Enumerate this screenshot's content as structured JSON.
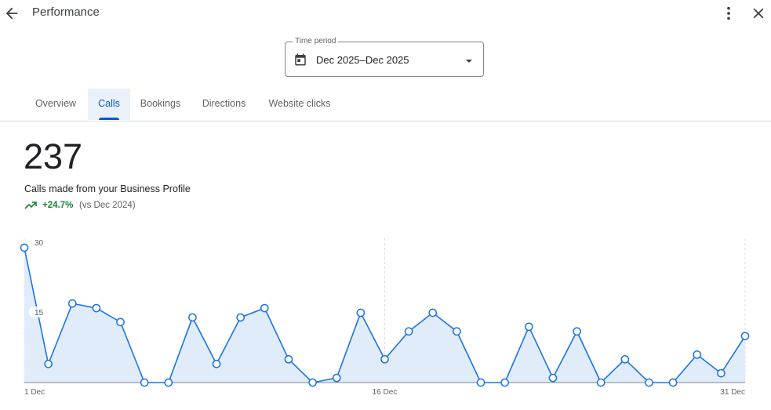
{
  "header": {
    "title": "Performance"
  },
  "time_period": {
    "label": "Time period",
    "value": "Dec 2025–Dec 2025"
  },
  "tabs": [
    {
      "label": "Overview",
      "active": false
    },
    {
      "label": "Calls",
      "active": true
    },
    {
      "label": "Bookings",
      "active": false
    },
    {
      "label": "Directions",
      "active": false
    },
    {
      "label": "Website clicks",
      "active": false
    }
  ],
  "summary": {
    "total": "237",
    "description": "Calls made from your Business Profile",
    "change": "+24.7%",
    "comparison": "(vs Dec 2024)"
  },
  "colors": {
    "accent": "#0b57d0",
    "line": "#1a73e8",
    "area": "#e1ecfb",
    "positive": "#188038"
  },
  "chart_data": {
    "type": "area",
    "x_tick_labels": [
      "1 Dec",
      "16 Dec",
      "31 Dec"
    ],
    "y_tick_labels": [
      "30",
      "15"
    ],
    "ylim": [
      0,
      30
    ],
    "x": [
      1,
      2,
      3,
      4,
      5,
      6,
      7,
      8,
      9,
      10,
      11,
      12,
      13,
      14,
      15,
      16,
      17,
      18,
      19,
      20,
      21,
      22,
      23,
      24,
      25,
      26,
      27,
      28,
      29,
      30,
      31
    ],
    "values": [
      29,
      4,
      17,
      16,
      13,
      0,
      0,
      14,
      4,
      14,
      16,
      5,
      0,
      1,
      15,
      5,
      11,
      15,
      11,
      0,
      0,
      12,
      1,
      11,
      0,
      5,
      0,
      0,
      6,
      2,
      10
    ]
  }
}
